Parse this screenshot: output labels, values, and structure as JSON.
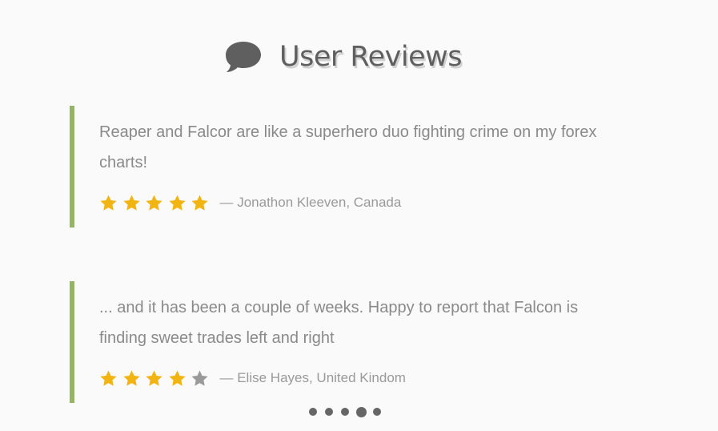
{
  "header": {
    "icon": "chat-bubble-icon",
    "title": "User Reviews"
  },
  "colors": {
    "accent_bar": "#95b36b",
    "star_filled": "#f2b411",
    "star_empty": "#9a9a9a",
    "text": "#8a8a8a",
    "title": "#5f5f5f"
  },
  "reviews": [
    {
      "quote": "Reaper and Falcor are like a superhero duo fighting crime on my forex charts!",
      "rating": 5,
      "max_rating": 5,
      "author": "— Jonathon Kleeven, Canada"
    },
    {
      "quote": "... and it has been a couple of weeks. Happy to report that Falcon is finding sweet trades left and right",
      "rating": 4,
      "max_rating": 5,
      "author": "— Elise Hayes, United Kindom"
    }
  ],
  "pager": {
    "count": 5,
    "active_index": 3
  }
}
